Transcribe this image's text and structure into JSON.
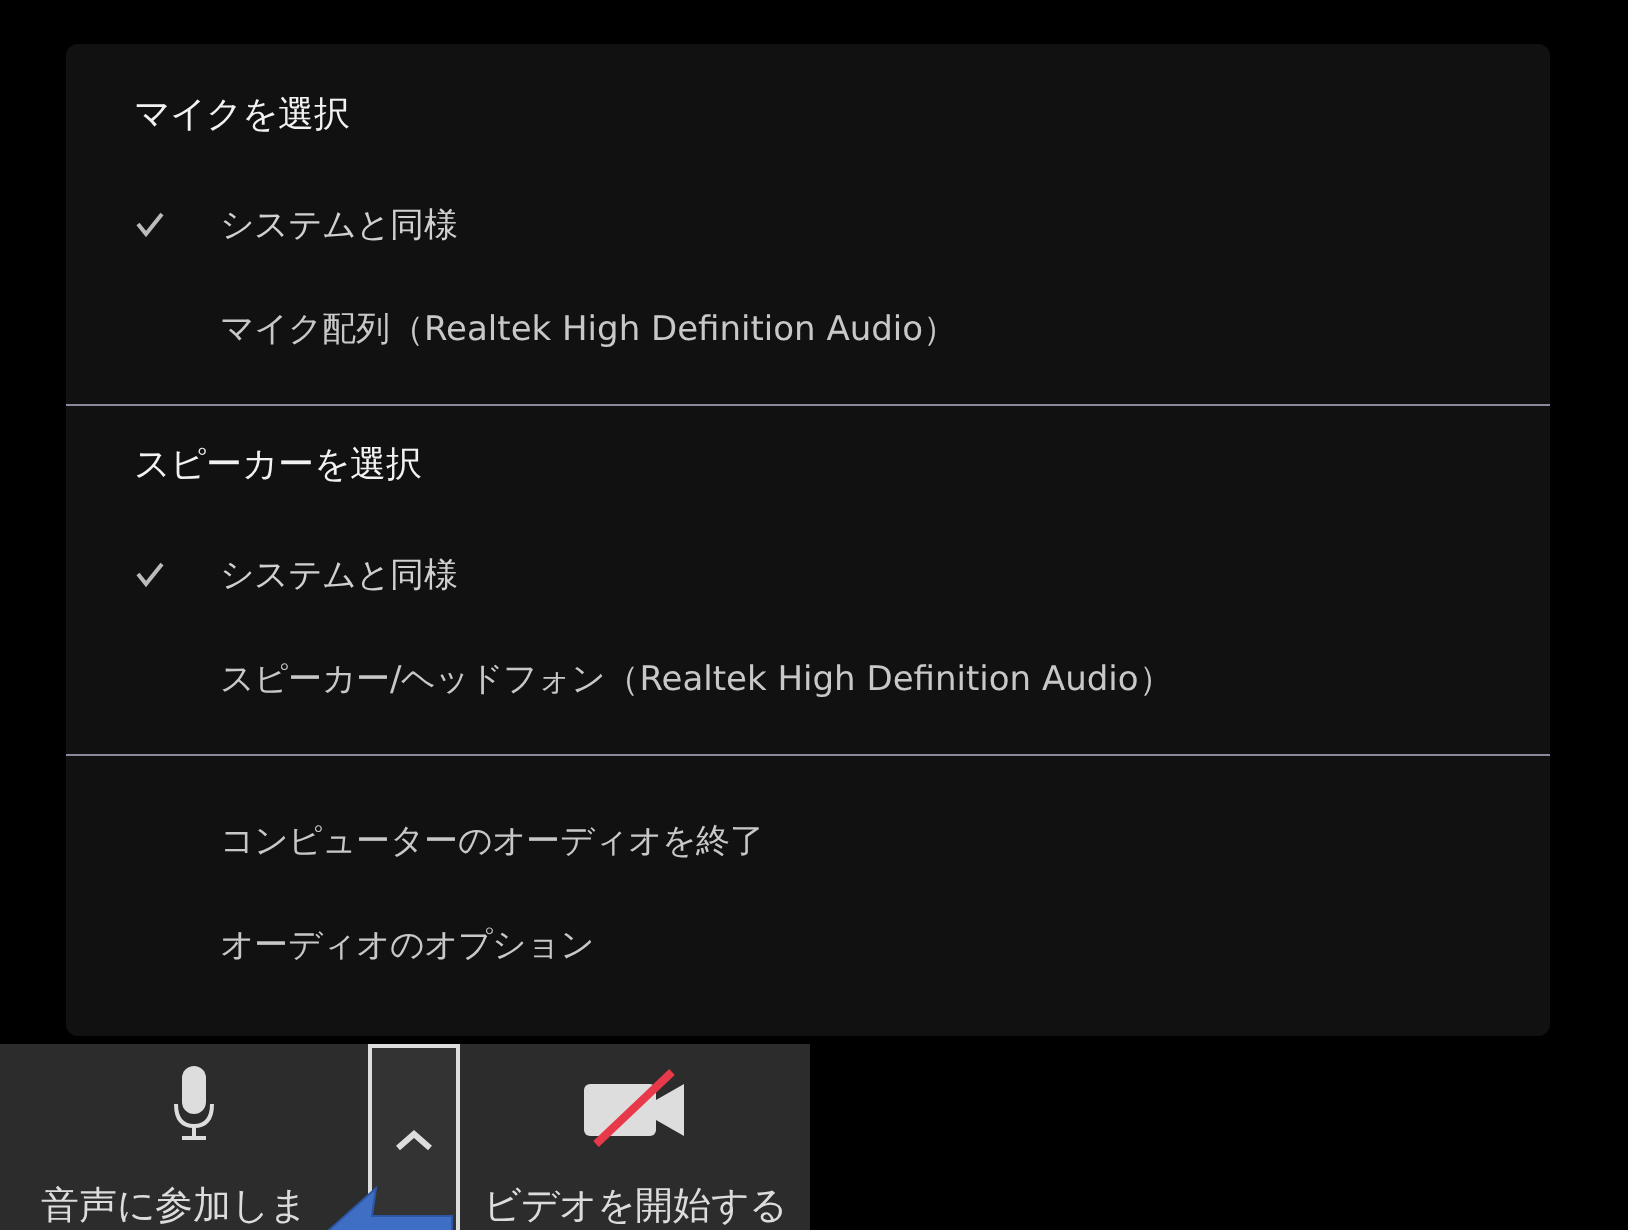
{
  "menu": {
    "sections": [
      {
        "heading": "マイクを選択",
        "items": [
          {
            "label": "システムと同様",
            "checked": true
          },
          {
            "label": "マイク配列（Realtek High Definition Audio）",
            "checked": false
          }
        ]
      },
      {
        "heading": "スピーカーを選択",
        "items": [
          {
            "label": "システムと同様",
            "checked": true
          },
          {
            "label": "スピーカー/ヘッドフォン（Realtek High Definition Audio）",
            "checked": false
          }
        ]
      },
      {
        "items": [
          {
            "label": "コンピューターのオーディオを終了",
            "checked": false
          },
          {
            "label": "オーディオのオプション",
            "checked": false
          }
        ]
      }
    ]
  },
  "toolbar": {
    "buttons": [
      {
        "kind": "mic",
        "label": "音声に参加しま"
      },
      {
        "kind": "caret",
        "selected": true
      },
      {
        "kind": "video",
        "label": "ビデオを開始する"
      }
    ]
  }
}
